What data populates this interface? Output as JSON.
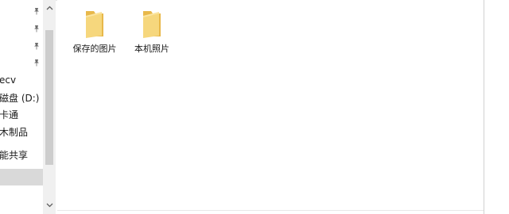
{
  "nav": {
    "items": [
      {
        "label": "",
        "pinned": true
      },
      {
        "label": "",
        "pinned": true
      },
      {
        "label": "",
        "pinned": true
      },
      {
        "label": "",
        "pinned": true
      },
      {
        "label": "ecv",
        "pinned": false
      },
      {
        "label": "磁盘 (D:)",
        "pinned": false
      },
      {
        "label": "卡通",
        "pinned": false
      },
      {
        "label": "木制品",
        "pinned": false
      },
      {
        "label": "能共享",
        "pinned": false
      },
      {
        "label": "",
        "pinned": false,
        "selected": true
      }
    ]
  },
  "content": {
    "folders": [
      {
        "name": "保存的图片",
        "icon": "folder-icon"
      },
      {
        "name": "本机照片",
        "icon": "folder-icon"
      }
    ]
  },
  "colors": {
    "folder_main": "#f6d77d",
    "folder_back": "#e8b84a",
    "selected_bg": "#d9d9d9",
    "scroll_thumb": "#cdcdcd"
  }
}
